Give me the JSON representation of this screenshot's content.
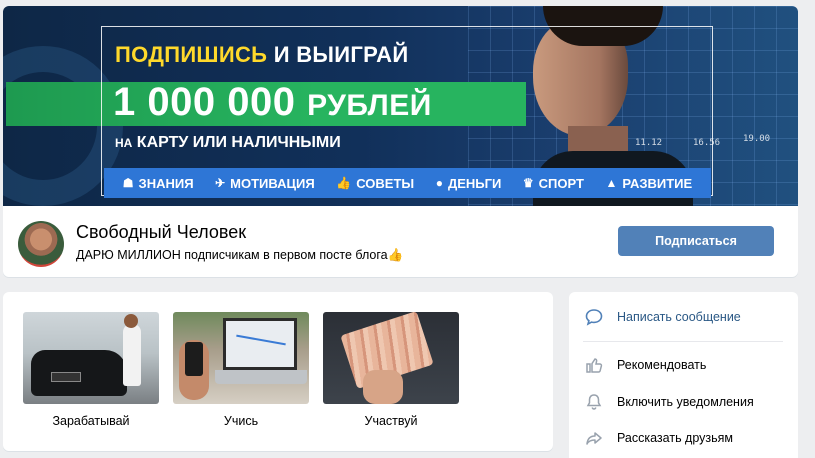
{
  "cover": {
    "line1_highlight": "ПОДПИШИСЬ",
    "line1_rest": "И ВЫИГРАЙ",
    "amount": "1 000 000",
    "currency": "РУБЛЕЙ",
    "sub_small": "НА",
    "sub_rest": "КАРТУ ИЛИ НАЛИЧНЫМИ",
    "categories": [
      {
        "label": "ЗНАНИЯ",
        "icon": "brain-icon"
      },
      {
        "label": "МОТИВАЦИЯ",
        "icon": "plane-icon"
      },
      {
        "label": "СОВЕТЫ",
        "icon": "thumbs-up-icon"
      },
      {
        "label": "ДЕНЬГИ",
        "icon": "coin-icon"
      },
      {
        "label": "СПОРТ",
        "icon": "trophy-icon"
      },
      {
        "label": "РАЗВИТИЕ",
        "icon": "chart-icon"
      }
    ],
    "chart_numbers": [
      "11.12",
      "16.56",
      "19.00"
    ]
  },
  "profile": {
    "name": "Свободный Человек",
    "status": "ДАРЮ МИЛЛИОН подписчикам в первом посте блога",
    "status_emoji": "👍",
    "subscribe_label": "Подписаться"
  },
  "albums": [
    {
      "caption": "Зарабатывай"
    },
    {
      "caption": "Учись"
    },
    {
      "caption": "Участвуй"
    }
  ],
  "actions": {
    "message": "Написать сообщение",
    "recommend": "Рекомендовать",
    "notify": "Включить уведомления",
    "share": "Рассказать друзьям"
  },
  "colors": {
    "accent": "#5181b8",
    "link": "#2a5885",
    "background": "#edeef0",
    "cover_yellow": "#ffd92b",
    "cover_green": "#27b45f",
    "cover_blue": "#2e76d6"
  }
}
